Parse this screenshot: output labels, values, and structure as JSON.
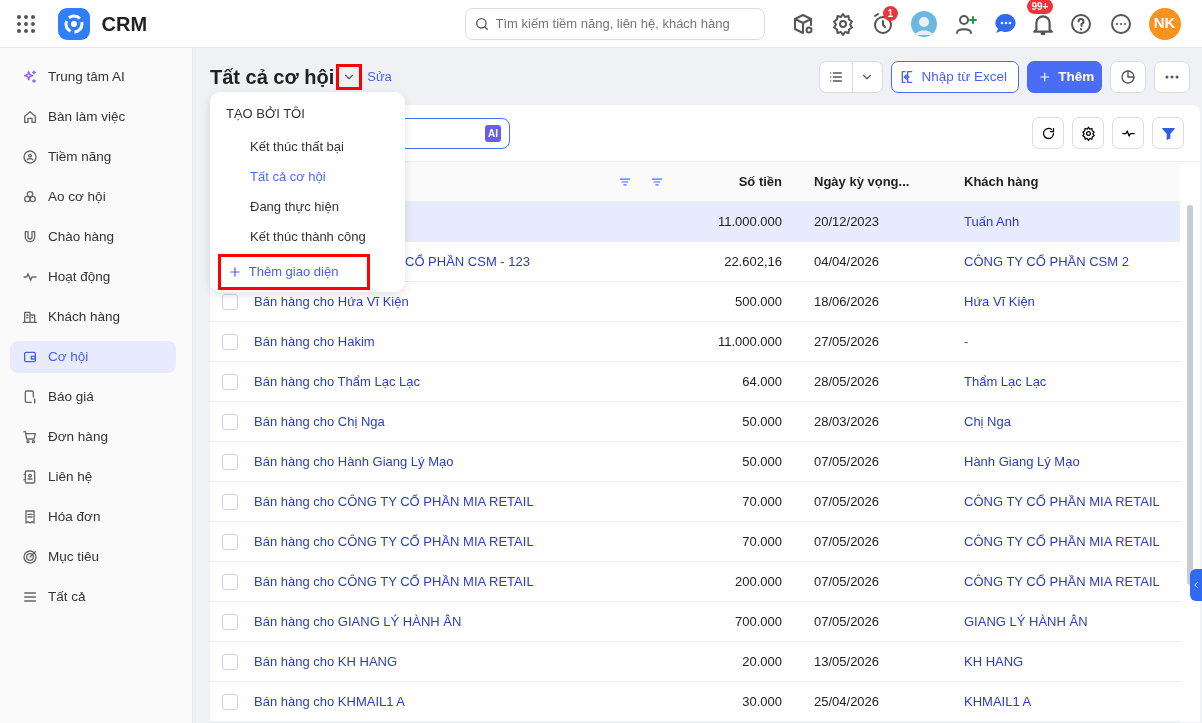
{
  "app": {
    "name": "CRM"
  },
  "search": {
    "placeholder": "Tìm kiếm tiềm năng, liên hệ, khách hàng"
  },
  "header_badges": {
    "timer": "1",
    "notifications": "99+"
  },
  "user": {
    "initials": "NK"
  },
  "sidebar": {
    "items": [
      {
        "label": "Trung tâm AI",
        "selected": false
      },
      {
        "label": "Bàn làm việc",
        "selected": false
      },
      {
        "label": "Tiềm năng",
        "selected": false
      },
      {
        "label": "Ao cơ hội",
        "selected": false
      },
      {
        "label": "Chào hàng",
        "selected": false
      },
      {
        "label": "Hoạt động",
        "selected": false
      },
      {
        "label": "Khách hàng",
        "selected": false
      },
      {
        "label": "Cơ hội",
        "selected": true
      },
      {
        "label": "Báo giá",
        "selected": false
      },
      {
        "label": "Đơn hàng",
        "selected": false
      },
      {
        "label": "Liên hệ",
        "selected": false
      },
      {
        "label": "Hóa đơn",
        "selected": false
      },
      {
        "label": "Mục tiêu",
        "selected": false
      },
      {
        "label": "Tất cả",
        "selected": false
      }
    ]
  },
  "page": {
    "title": "Tất cả cơ hội",
    "edit_link": "Sửa",
    "import_button": "Nhập từ Excel",
    "add_button": "Thêm"
  },
  "view_menu": {
    "toggle_highlighted": true,
    "section": "TẠO BỞI TÔI",
    "items": [
      {
        "label": "Kết thúc thất bại",
        "selected": false
      },
      {
        "label": "Tất cả cơ hội",
        "selected": true
      },
      {
        "label": "Đang thực hiện",
        "selected": false
      },
      {
        "label": "Kết thúc thành công",
        "selected": false
      }
    ],
    "add_view": {
      "label": "Thêm giao diện",
      "highlighted": true
    }
  },
  "filter_field": {
    "ai_badge": "AI"
  },
  "table": {
    "columns": [
      "Số tiền",
      "Ngày kỳ vọng...",
      "Khách hàng"
    ],
    "rows": [
      {
        "amount": "11.000.000",
        "date": "20/12/2023",
        "customer": "Tuấn Anh",
        "selected": true,
        "partial": true
      },
      {
        "name": "CỔ PHẦN CSM - 123",
        "amount": "22.602,16",
        "date": "04/04/2026",
        "customer": "CÔNG TY CỔ PHẦN CSM 2",
        "selected": false,
        "partial": true
      },
      {
        "name": "Bán hàng cho Hứa Vĩ Kiện",
        "amount": "500.000",
        "date": "18/06/2026",
        "customer": "Hứa Vĩ Kiện",
        "selected": false
      },
      {
        "name": "Bán hàng cho Hakim",
        "amount": "11.000.000",
        "date": "27/05/2026",
        "customer": "-",
        "customer_link": false,
        "selected": false
      },
      {
        "name": "Bán hàng cho Thẩm Lạc Lạc",
        "amount": "64.000",
        "date": "28/05/2026",
        "customer": "Thẩm Lạc Lạc",
        "selected": false
      },
      {
        "name": "Bán hàng cho Chị Nga",
        "amount": "50.000",
        "date": "28/03/2026",
        "customer": "Chị Nga",
        "selected": false
      },
      {
        "name": "Bán hàng cho Hành Giang Lý Mạo",
        "amount": "50.000",
        "date": "07/05/2026",
        "customer": "Hành Giang Lý Mạo",
        "selected": false
      },
      {
        "name": "Bán hàng cho CÔNG TY CỔ PHẦN MIA RETAIL",
        "amount": "70.000",
        "date": "07/05/2026",
        "customer": "CÔNG TY CỔ PHẦN MIA RETAIL",
        "selected": false
      },
      {
        "name": "Bán hàng cho CÔNG TY CỔ PHẦN MIA RETAIL",
        "amount": "70.000",
        "date": "07/05/2026",
        "customer": "CÔNG TY CỔ PHẦN MIA RETAIL",
        "selected": false
      },
      {
        "name": "Bán hàng cho CÔNG TY CỔ PHẦN MIA RETAIL",
        "amount": "200.000",
        "date": "07/05/2026",
        "customer": "CÔNG TY CỔ PHẦN MIA RETAIL",
        "selected": false
      },
      {
        "name": "Bán hàng cho GIANG LÝ HÀNH ÂN",
        "amount": "700.000",
        "date": "07/05/2026",
        "customer": "GIANG LÝ HÀNH ÂN",
        "selected": false
      },
      {
        "name": "Bán hàng cho KH HANG",
        "amount": "20.000",
        "date": "13/05/2026",
        "customer": "KH HANG",
        "selected": false
      },
      {
        "name": "Bán hàng cho KHMAIL1 A",
        "amount": "30.000",
        "date": "25/04/2026",
        "customer": "KHMAIL1 A",
        "selected": false
      }
    ]
  }
}
